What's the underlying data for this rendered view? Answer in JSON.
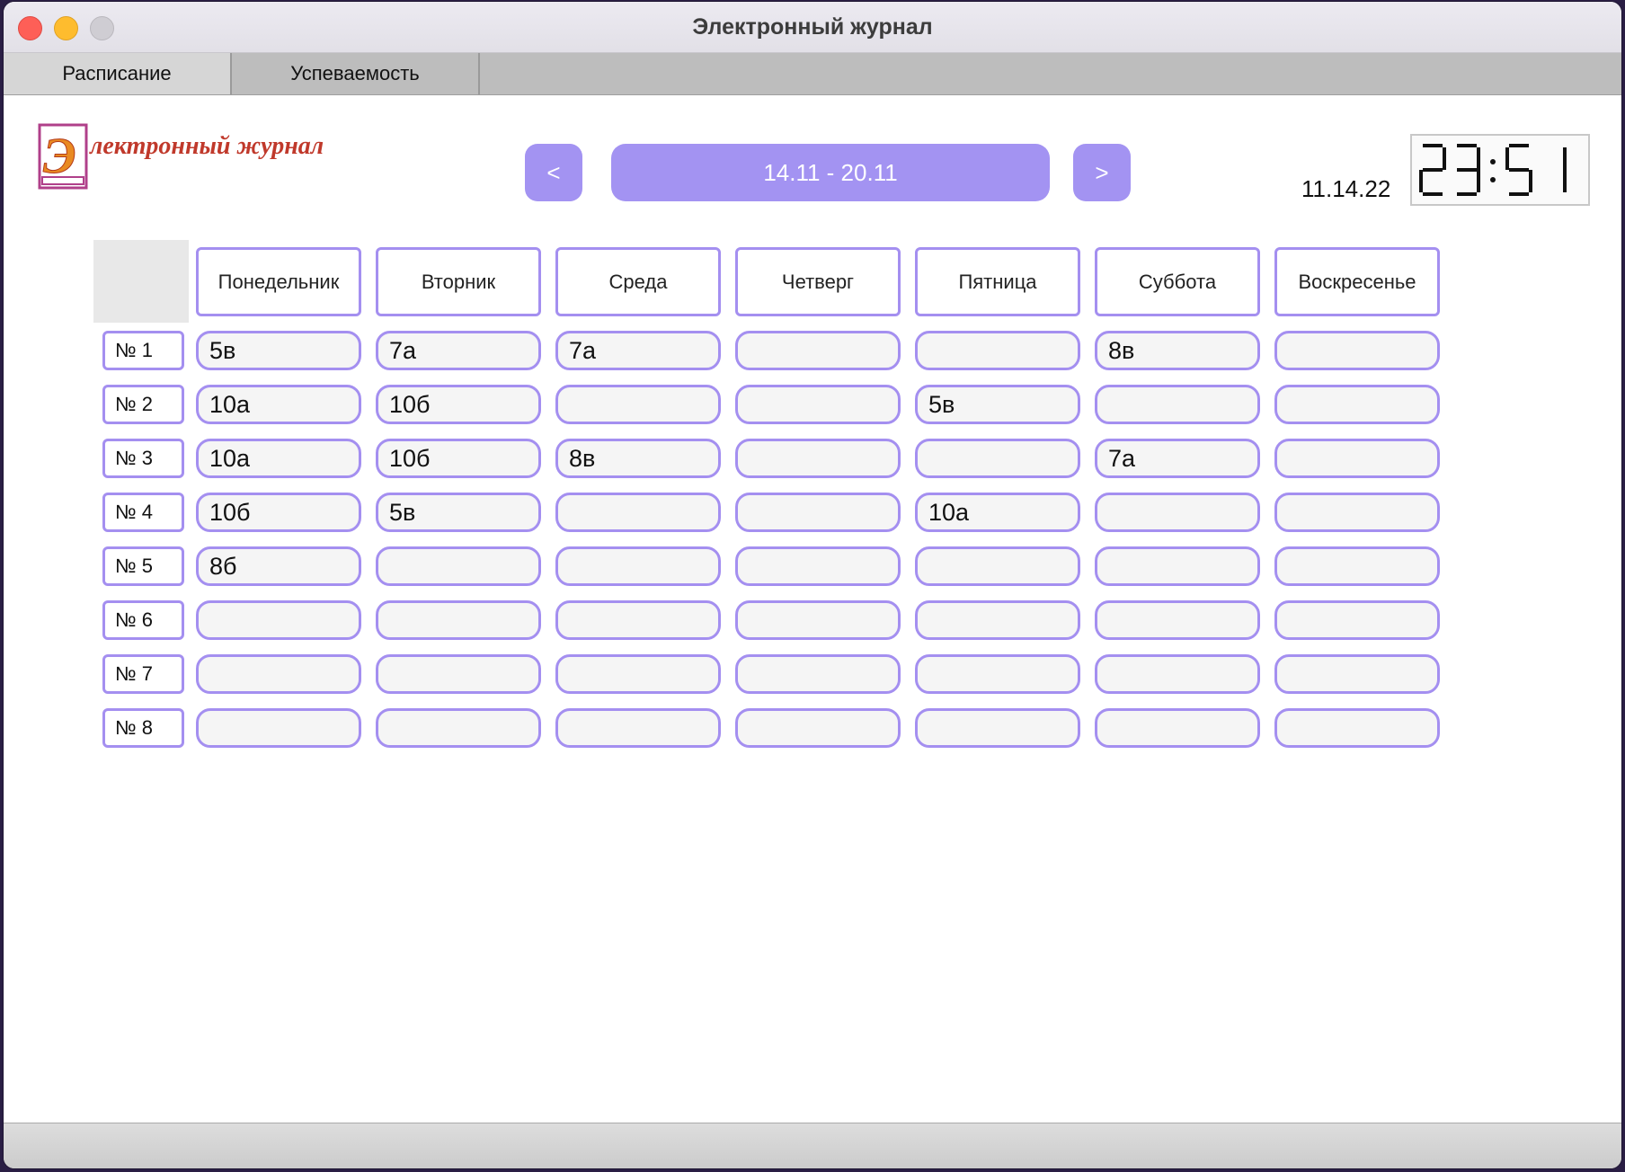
{
  "window": {
    "title": "Электронный журнал"
  },
  "tabs": [
    {
      "label": "Расписание",
      "active": true
    },
    {
      "label": "Успеваемость",
      "active": false
    }
  ],
  "logo": {
    "text": "лектронный журнал",
    "letter": "Э"
  },
  "week_nav": {
    "prev_label": "<",
    "range": "14.11 - 20.11",
    "next_label": ">"
  },
  "date": "11.14.22",
  "clock": {
    "time": "23:51"
  },
  "days": [
    "Понедельник",
    "Вторник",
    "Среда",
    "Четверг",
    "Пятница",
    "Суббота",
    "Воскресенье"
  ],
  "lessons": [
    "№ 1",
    "№ 2",
    "№ 3",
    "№ 4",
    "№ 5",
    "№ 6",
    "№ 7",
    "№ 8"
  ],
  "schedule": [
    [
      "5в",
      "7а",
      "7а",
      "",
      "",
      "8в",
      ""
    ],
    [
      "10а",
      "10б",
      "",
      "",
      "5в",
      "",
      ""
    ],
    [
      "10а",
      "10б",
      "8в",
      "",
      "",
      "7а",
      ""
    ],
    [
      "10б",
      "5в",
      "",
      "",
      "10а",
      "",
      ""
    ],
    [
      "8б",
      "",
      "",
      "",
      "",
      "",
      ""
    ],
    [
      "",
      "",
      "",
      "",
      "",
      "",
      ""
    ],
    [
      "",
      "",
      "",
      "",
      "",
      "",
      ""
    ],
    [
      "",
      "",
      "",
      "",
      "",
      "",
      ""
    ]
  ],
  "colors": {
    "accent": "#a393f2",
    "cell_border": "#a48ff0",
    "cell_fill": "#f5f5f5",
    "logo_text": "#c0392b",
    "logo_book": "#b0408a",
    "logo_letter": "#e98a22"
  }
}
